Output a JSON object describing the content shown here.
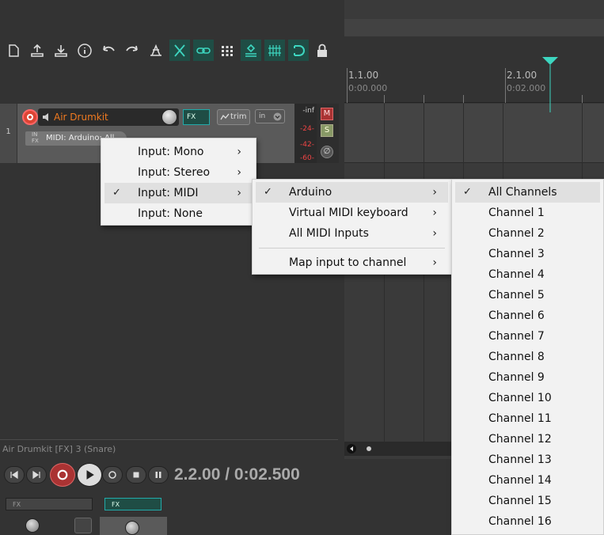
{
  "colors": {
    "accent": "#1f4d45",
    "track_name": "#f07a20",
    "menu_bg": "#f2f2f2",
    "menu_highlight": "#e0e0e0"
  },
  "toolbar": {
    "icons": [
      "new-project-icon",
      "save-icon",
      "open-icon",
      "info-icon",
      "undo-icon",
      "redo-icon",
      "metronome-icon",
      "ripple-edit-icon",
      "link-icon",
      "grid-icon",
      "group-icon",
      "snap-grid-icon",
      "snap-icon",
      "lock-icon"
    ]
  },
  "ruler": {
    "marker1_label": "1.1.00",
    "marker1_time": "0:00.000",
    "marker2_label": "2.1.00",
    "marker2_time": "0:02.000"
  },
  "track": {
    "number": "1",
    "name": "Air Drumkit",
    "fx_label": "FX",
    "trim_label": "trim",
    "in_label": "in",
    "infx_label": "IN FX",
    "input_label": "MIDI: Arduino: All",
    "meter": [
      "-inf",
      "-24-",
      "-42-",
      "-60-"
    ],
    "mute_label": "M",
    "solo_label": "S",
    "phase_label": "∅"
  },
  "bottom": {
    "title": "Air Drumkit [FX] 3 (Snare)",
    "time": "2.2.00 / 0:02.500",
    "fx1_label": "FX",
    "fx2_label": "FX"
  },
  "menu1": {
    "items": [
      {
        "label": "Input: Mono",
        "checked": false,
        "submenu": true
      },
      {
        "label": "Input: Stereo",
        "checked": false,
        "submenu": true
      },
      {
        "label": "Input: MIDI",
        "checked": true,
        "submenu": true
      },
      {
        "label": "Input: None",
        "checked": false,
        "submenu": false
      }
    ]
  },
  "menu2": {
    "items": [
      {
        "label": "Arduino",
        "checked": true,
        "submenu": true
      },
      {
        "label": "Virtual MIDI keyboard",
        "checked": false,
        "submenu": true
      },
      {
        "label": "All MIDI Inputs",
        "checked": false,
        "submenu": true
      }
    ],
    "map_item": {
      "label": "Map input to channel",
      "submenu": true
    }
  },
  "menu3": {
    "items": [
      {
        "label": "All Channels",
        "checked": true
      },
      {
        "label": "Channel 1"
      },
      {
        "label": "Channel 2"
      },
      {
        "label": "Channel 3"
      },
      {
        "label": "Channel 4"
      },
      {
        "label": "Channel 5"
      },
      {
        "label": "Channel 6"
      },
      {
        "label": "Channel 7"
      },
      {
        "label": "Channel 8"
      },
      {
        "label": "Channel 9"
      },
      {
        "label": "Channel 10"
      },
      {
        "label": "Channel 11"
      },
      {
        "label": "Channel 12"
      },
      {
        "label": "Channel 13"
      },
      {
        "label": "Channel 14"
      },
      {
        "label": "Channel 15"
      },
      {
        "label": "Channel 16"
      }
    ]
  },
  "glyphs": {
    "check": "✓",
    "arrow": "›"
  }
}
